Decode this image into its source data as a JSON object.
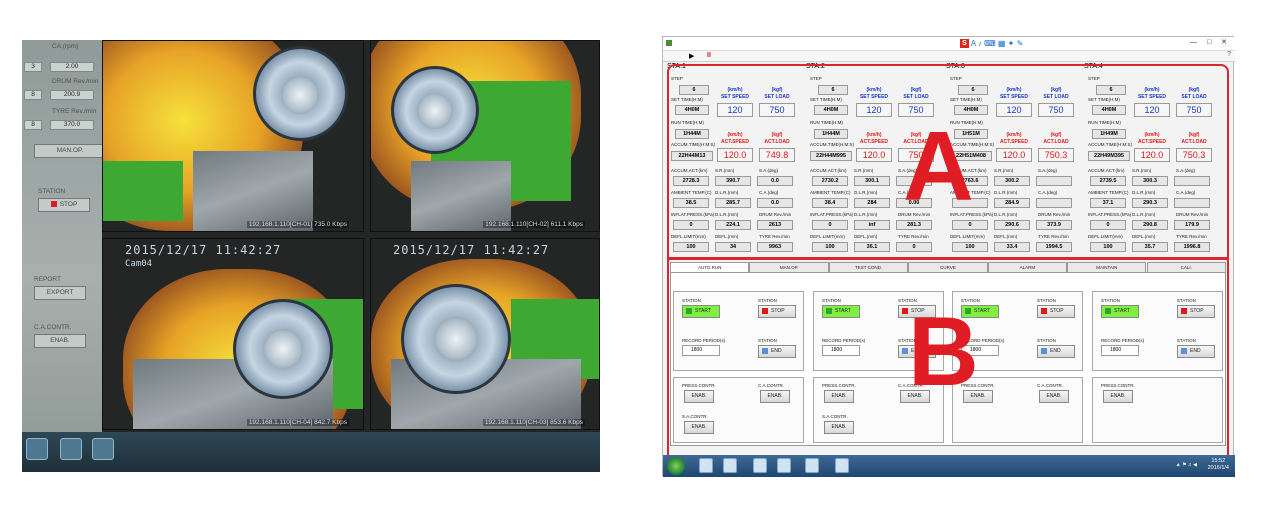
{
  "photo": {
    "left_panel": {
      "top_label": "CA.(rpm)",
      "rows": [
        {
          "left": "3",
          "right": "2.00"
        },
        {
          "left": "8",
          "right": "200.9"
        },
        {
          "left": "8",
          "right": "370.0"
        }
      ],
      "row_labels": [
        "DRUM Rev./min",
        "TYRE Rev./min"
      ],
      "manop_label": "MAN.OP.",
      "station_label": "STATION",
      "stop_label": "STOP",
      "report_label": "REPORT",
      "export_label": "EXPORT",
      "ca_contr_label": "C.A.CONTR.",
      "enab_label": "ENAB."
    },
    "cams": [
      {
        "stamp": "",
        "id": "",
        "caption": "192.168.1.110[CH-01]  735.0 Kbps"
      },
      {
        "stamp": "",
        "id": "",
        "caption": "192.168.1.110[CH-02]  611.1 Kbps"
      },
      {
        "stamp": "2015/12/17  11:42:27",
        "id": "Cam04",
        "caption": "192.168.1.110[CH-04]  842.7 Kbps"
      },
      {
        "stamp": "2015/12/17  11:42:27",
        "id": "",
        "caption": "192.168.1.110[CH-03]  853.6 Kbps"
      }
    ]
  },
  "shot": {
    "title": "",
    "toolbar": {
      "run_icon": "▶",
      "pause_icon": "II"
    },
    "stations": [
      {
        "name": "STA.1",
        "step": "6",
        "set_time": "4H0M",
        "run_time": "1H44M",
        "accum_time": "22H44M13",
        "set_speed": "120",
        "set_load": "750",
        "act_speed": "120.0",
        "act_load": "749.8",
        "accum_act": "2728.3",
        "sr": "390.7",
        "sa": "0.0",
        "ambient": "38.5",
        "dlr": "285.7",
        "ca_deg": "0.0",
        "inflat": "0",
        "dlr2": "224.1",
        "drum_rev": "2613",
        "defl_limit": "100",
        "defl": "34",
        "tyre_rev": "9963"
      },
      {
        "name": "STA.2",
        "step": "6",
        "set_time": "4H0M",
        "run_time": "1H44M",
        "accum_time": "22H44M995",
        "set_speed": "120",
        "set_load": "750",
        "act_speed": "120.0",
        "act_load": "750",
        "accum_act": "2730.2",
        "sr": "300.1",
        "sa": "",
        "ambient": "38.4",
        "dlr": "284",
        "ca_deg": "0.00",
        "inflat": "0",
        "dlr2": "inf",
        "drum_rev": "281.3",
        "defl_limit": "100",
        "defl": "36.1",
        "tyre_rev": "0"
      },
      {
        "name": "STA.3",
        "step": "6",
        "set_time": "4H0M",
        "run_time": "1H51M",
        "accum_time": "22H51M408",
        "set_speed": "120",
        "set_load": "750",
        "act_speed": "120.0",
        "act_load": "750.3",
        "accum_act": "2763.6",
        "sr": "300.2",
        "sa": "",
        "ambient": "",
        "dlr": "284.9",
        "ca_deg": "",
        "inflat": "0",
        "dlr2": "290.6",
        "drum_rev": "373.9",
        "defl_limit": "100",
        "defl": "33.4",
        "tyre_rev": "1994.5"
      },
      {
        "name": "STA.4",
        "step": "6",
        "set_time": "4H0M",
        "run_time": "1H49M",
        "accum_time": "22H49M395",
        "set_speed": "120",
        "set_load": "750",
        "act_speed": "120.0",
        "act_load": "750.3",
        "accum_act": "2739.5",
        "sr": "300.3",
        "sa": "",
        "ambient": "37.1",
        "dlr": "290.3",
        "ca_deg": "",
        "inflat": "0",
        "dlr2": "290.8",
        "drum_rev": "179.9",
        "defl_limit": "100",
        "defl": "35.7",
        "tyre_rev": "1996.8"
      }
    ],
    "labels": {
      "step": "STEP",
      "set_time": "SET TIME(H:M)",
      "run_time": "RUN TIME(H:M)",
      "accum_time": "ACCUM.TIME(H:M:S)",
      "kmh": "(km/h)",
      "kgf": "(kgf)",
      "set_speed": "SET SPEED",
      "set_load": "SET LOAD",
      "act_speed": "ACT.SPEED",
      "act_load": "ACT.LOAD",
      "accum_act": "ACCUM.ACT.(km)",
      "sr": "S.R.(mm)",
      "sa": "S.A.(deg)",
      "ambient": "AMBIENT TEMP.(C)",
      "dlr": "D.L.R.(mm)",
      "ca": "C.A.(deg)",
      "inflat": "INFLAT.PRESS.(kPa)",
      "dlr2": "D.L.R.(mm)",
      "drum": "DRUM Rev./min",
      "defl_limit": "DEFL.LIMIT(mm)",
      "defl": "DEFL.(mm)",
      "tyre": "TYRE Rev./min"
    },
    "tabs": [
      "AUTO.RUN",
      "MAN.OP.",
      "TEST COND.",
      "CURVE",
      "ALARM",
      "MAINTAIN",
      "CALI."
    ],
    "controls": {
      "station": "STATION",
      "start": "START",
      "stop": "STOP",
      "record": "RECORD PERIOD(s)",
      "record_value": "1800",
      "end": "END",
      "press_contr": "PRESS.CONTR.",
      "ca_contr": "C.A.CONTR.",
      "sa_contr": "S.A.CONTR.",
      "enab": "ENAB."
    },
    "overlay": {
      "a": "A",
      "b": "B"
    },
    "clock": {
      "time": "15:52",
      "date": "2016/1/4"
    }
  },
  "colors": {
    "annotation_red": "#e01d25",
    "start_green": "#80f040",
    "stop_red": "#e01818",
    "label_blue": "#1238c8"
  }
}
